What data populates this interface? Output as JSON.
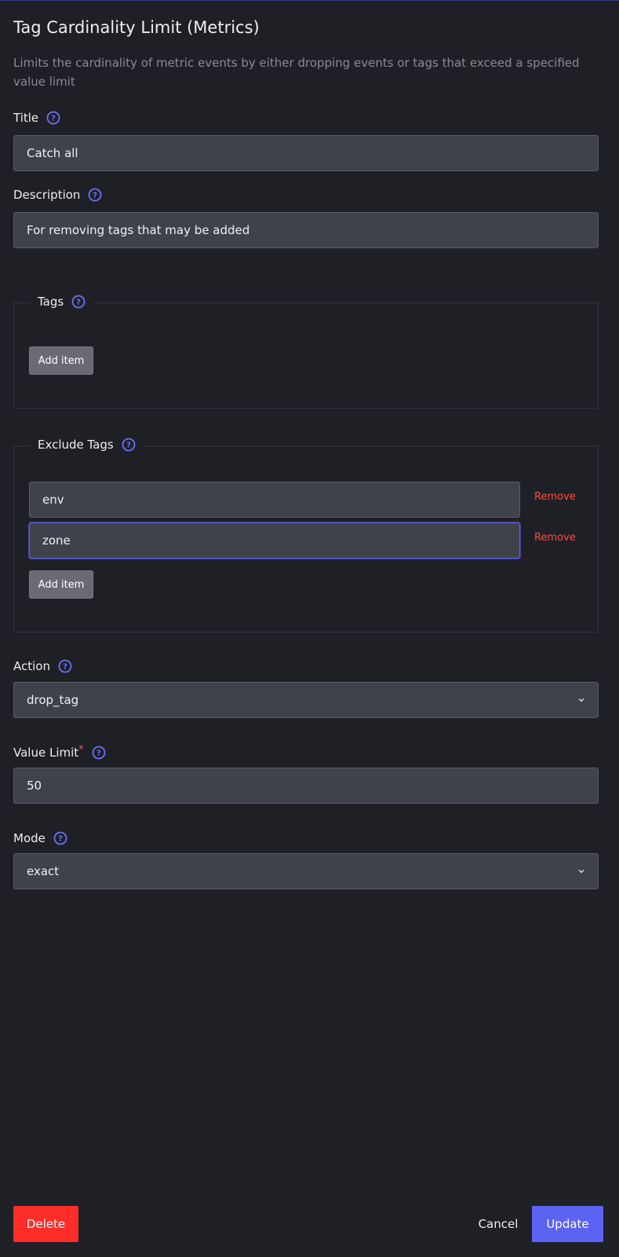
{
  "header": {
    "title": "Tag Cardinality Limit (Metrics)",
    "description": "Limits the cardinality of metric events by either dropping events or tags that exceed a specified value limit"
  },
  "fields": {
    "title": {
      "label": "Title",
      "value": "Catch all",
      "help_icon": "question-circle-icon"
    },
    "description": {
      "label": "Description",
      "value": "For removing tags that may be added",
      "help_icon": "question-circle-icon"
    },
    "tags": {
      "label": "Tags",
      "items": [],
      "add_label": "Add item",
      "help_icon": "question-circle-icon"
    },
    "exclude_tags": {
      "label": "Exclude Tags",
      "items": [
        {
          "value": "env",
          "remove_label": "Remove"
        },
        {
          "value": "zone",
          "remove_label": "Remove"
        }
      ],
      "add_label": "Add item",
      "help_icon": "question-circle-icon"
    },
    "action": {
      "label": "Action",
      "selected": "drop_tag",
      "help_icon": "question-circle-icon"
    },
    "value_limit": {
      "label": "Value Limit",
      "required_mark": "*",
      "value": "50",
      "help_icon": "question-circle-icon"
    },
    "mode": {
      "label": "Mode",
      "selected": "exact",
      "help_icon": "question-circle-icon"
    }
  },
  "footer": {
    "delete_label": "Delete",
    "cancel_label": "Cancel",
    "update_label": "Update"
  },
  "colors": {
    "background": "#1f2026",
    "input_bg": "#40424b",
    "accent": "#5c63f2",
    "danger": "#ff2d28",
    "remove_text": "#ff4b3f",
    "help_icon": "#6b70f5"
  }
}
